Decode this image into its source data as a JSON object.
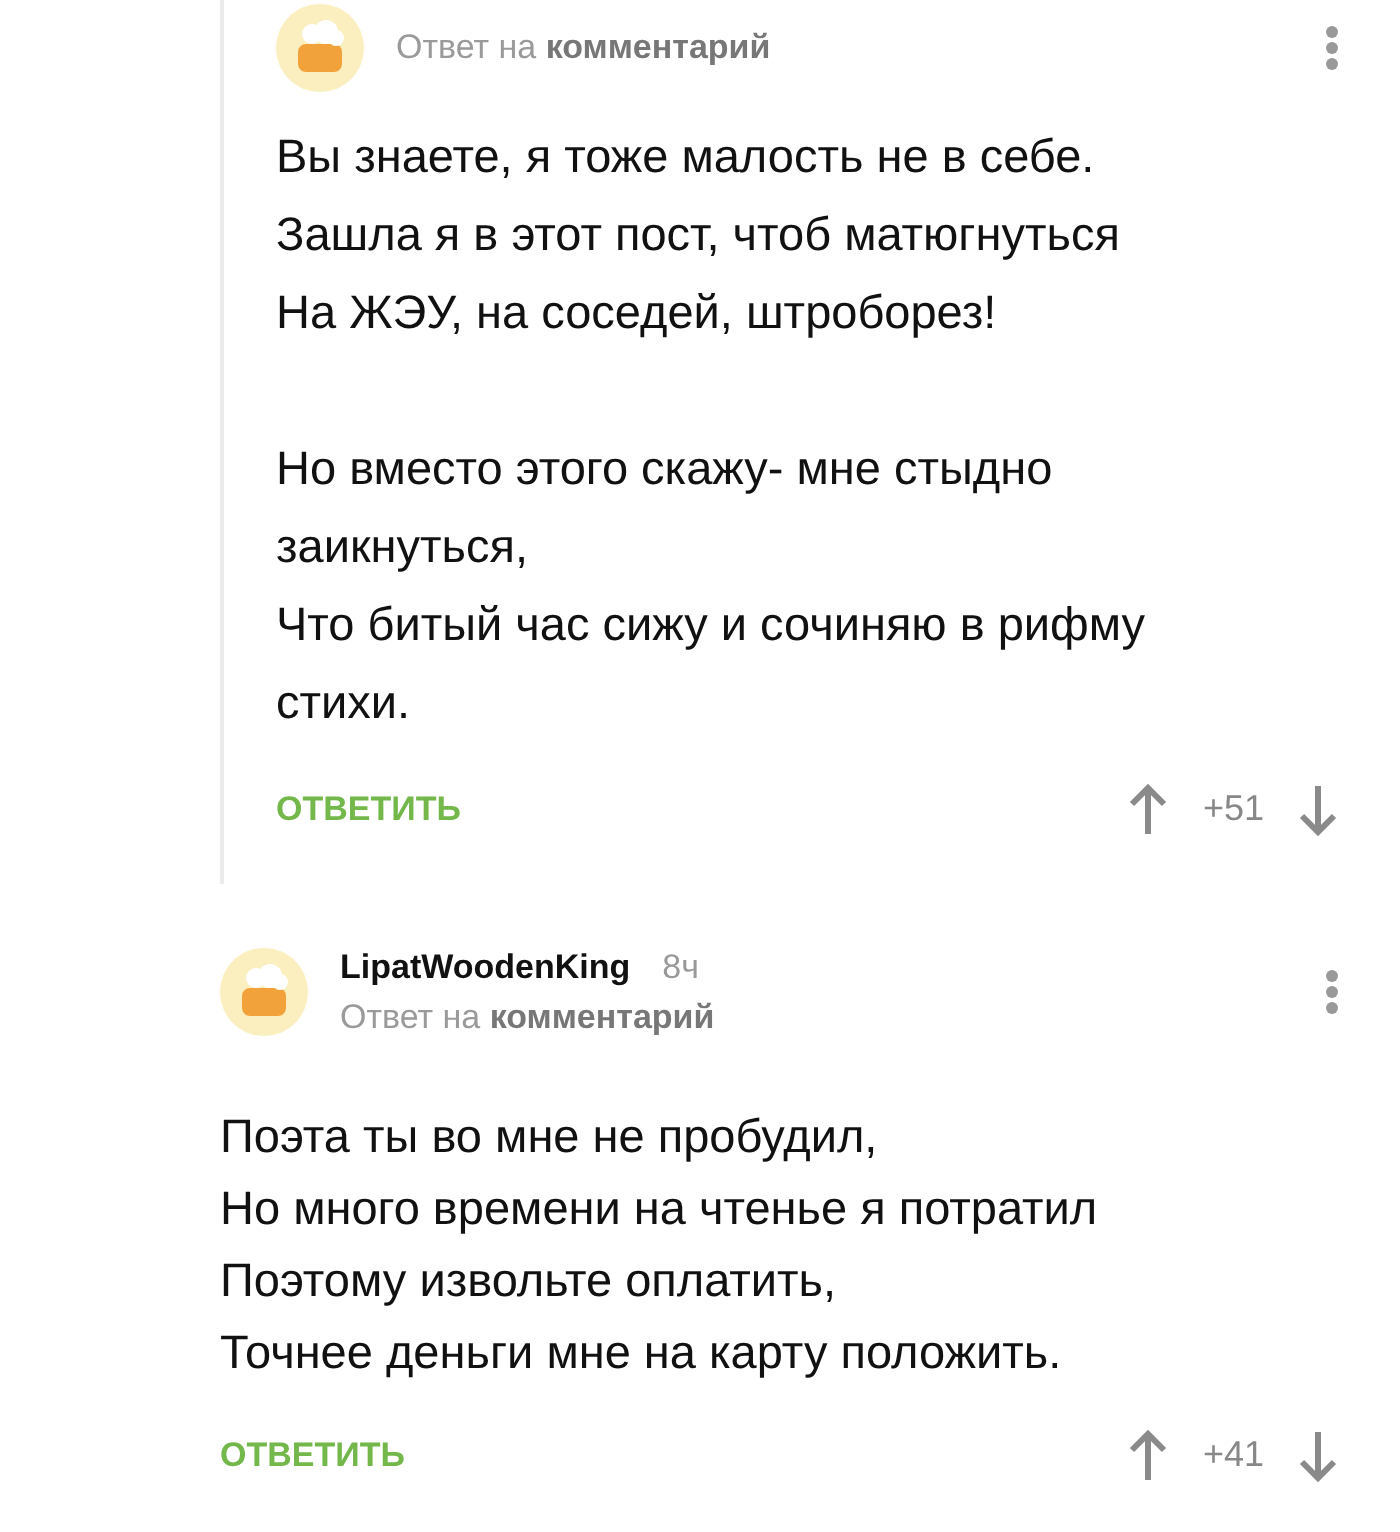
{
  "comments": [
    {
      "reply_label": "Ответ на",
      "reply_target": "комментарий",
      "thread_line": true,
      "paragraphs": [
        [
          "Вы знаете, я тоже малость не в себе.",
          "Зашла я в этот пост, чтоб матюгнуться",
          "На ЖЭУ, на соседей, штроборез!"
        ],
        [
          "Но вместо этого скажу- мне стыдно заикнуться,",
          "Что битый час сижу и сочиняю в рифму стихи."
        ]
      ],
      "reply_button": "ОТВЕТИТЬ",
      "score": "+51"
    },
    {
      "author": "LipatWoodenKing",
      "time": "8ч",
      "reply_label": "Ответ на",
      "reply_target": "комментарий",
      "thread_line": false,
      "paragraphs": [
        [
          "Поэта ты во мне не пробудил,",
          "Но много времени на чтенье я потратил",
          "Поэтому извольте оплатить,",
          "Точнее деньги мне на карту положить."
        ]
      ],
      "reply_button": "ОТВЕТИТЬ",
      "score": "+41"
    }
  ]
}
